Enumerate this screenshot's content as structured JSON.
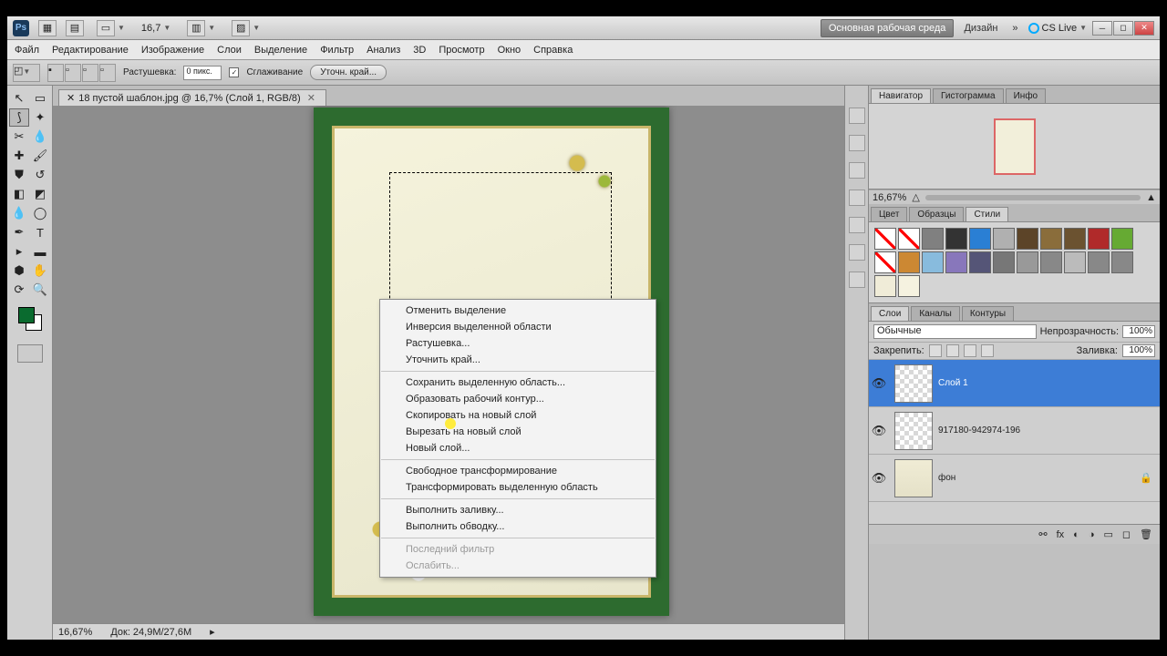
{
  "topbar": {
    "zoom": "16,7",
    "workspace_btn": "Основная рабочая среда",
    "design": "Дизайн",
    "cslive": "CS Live"
  },
  "menu": [
    "Файл",
    "Редактирование",
    "Изображение",
    "Слои",
    "Выделение",
    "Фильтр",
    "Анализ",
    "3D",
    "Просмотр",
    "Окно",
    "Справка"
  ],
  "options": {
    "feather_label": "Растушевка:",
    "feather_val": "0 пикс.",
    "antialias": "Сглаживание",
    "refine": "Уточн. край..."
  },
  "tab": {
    "title": "18 пустой шаблон.jpg @ 16,7% (Слой 1, RGB/8)"
  },
  "context": {
    "g1": [
      "Отменить выделение",
      "Инверсия выделенной области",
      "Растушевка...",
      "Уточнить край..."
    ],
    "g2": [
      "Сохранить выделенную область...",
      "Образовать рабочий контур...",
      "Скопировать на новый слой",
      "Вырезать на новый слой",
      "Новый слой..."
    ],
    "g3": [
      "Свободное трансформирование",
      "Трансформировать выделенную область"
    ],
    "g4": [
      "Выполнить заливку...",
      "Выполнить обводку..."
    ],
    "g5": [
      "Последний фильтр",
      "Ослабить..."
    ]
  },
  "status": {
    "zoom": "16,67%",
    "doc": "Док: 24,9M/27,6M"
  },
  "panels": {
    "nav_tabs": [
      "Навигатор",
      "Гистограмма",
      "Инфо"
    ],
    "nav_zoom": "16,67%",
    "color_tabs": [
      "Цвет",
      "Образцы",
      "Стили"
    ],
    "layer_tabs": [
      "Слои",
      "Каналы",
      "Контуры"
    ],
    "blend": "Обычные",
    "opacity_label": "Непрозрачность:",
    "opacity": "100%",
    "lock_label": "Закрепить:",
    "fill_label": "Заливка:",
    "fill": "100%",
    "layers": [
      {
        "name": "Слой 1",
        "sel": true,
        "thumb": "check"
      },
      {
        "name": "917180-942974-196",
        "sel": false,
        "thumb": "check"
      },
      {
        "name": "фон",
        "sel": false,
        "thumb": "img",
        "locked": true
      }
    ]
  },
  "swatch_colors": [
    "#ffffff00",
    "#ff6600",
    "#808080",
    "#333333",
    "#2a7fd4",
    "#b0b0b0",
    "#5c4428",
    "#8a6d3b",
    "#6b5230",
    "#b02a2a",
    "#66aa33",
    "#ffcc00",
    "#cc8833",
    "#88bbdd",
    "#8877bb",
    "#555577",
    "#777777",
    "#999999",
    "#888888",
    "#bbbbbb",
    "#888888",
    "#888888",
    "#f0ecd8",
    "#f5f2e0"
  ]
}
